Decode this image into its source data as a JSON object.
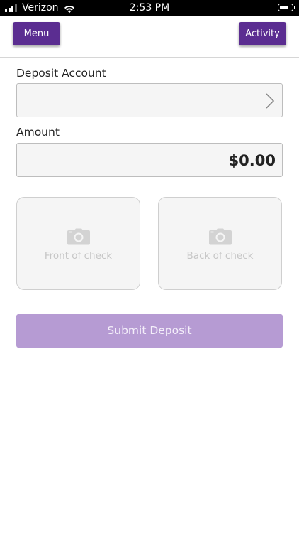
{
  "status_bar": {
    "carrier": "Verizon",
    "time": "2:53 PM",
    "signal_bars_active": 3,
    "signal_bars_total": 4,
    "battery_level": 0.72
  },
  "nav": {
    "menu_label": "Menu",
    "activity_label": "Activity",
    "accent_color": "#5b2d91"
  },
  "form": {
    "deposit_account_label": "Deposit Account",
    "deposit_account_value": "",
    "amount_label": "Amount",
    "amount_value": "$0.00"
  },
  "check_images": {
    "front_label": "Front of check",
    "back_label": "Back of check",
    "icon": "camera-icon"
  },
  "submit": {
    "label": "Submit Deposit",
    "color": "#b69bd3"
  }
}
